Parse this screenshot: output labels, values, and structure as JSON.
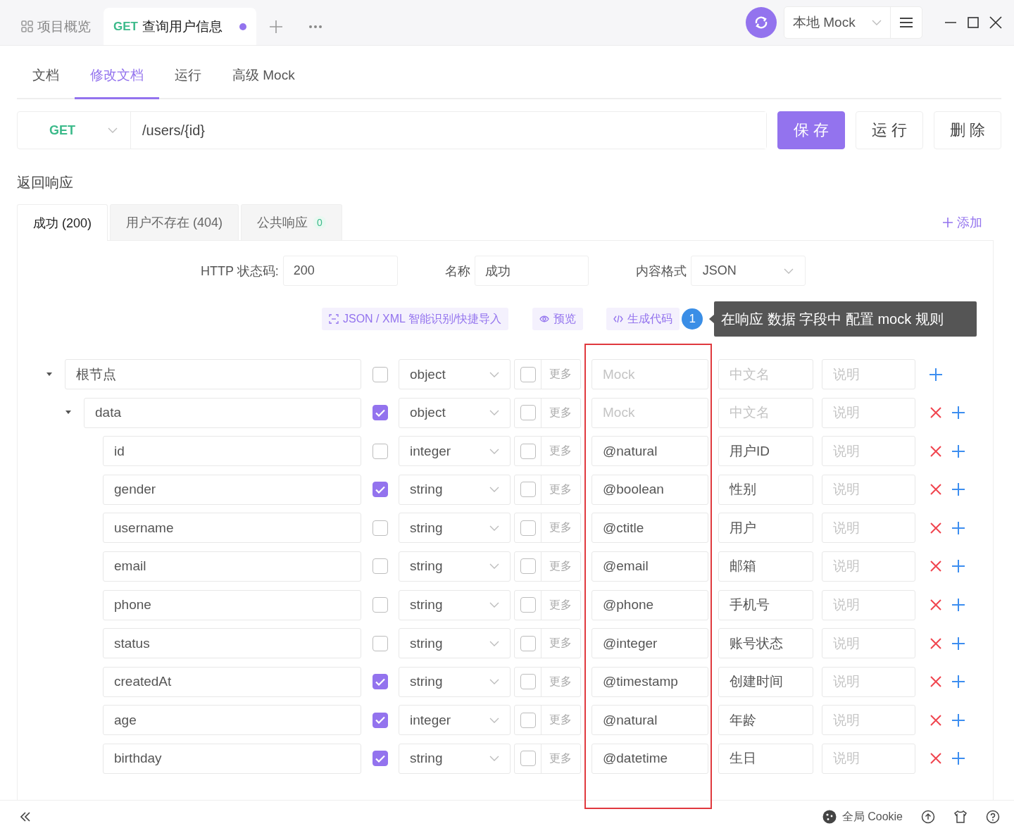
{
  "tabs": [
    {
      "kind": "overview",
      "label": "项目概览",
      "selected": false
    },
    {
      "kind": "request",
      "method": "GET",
      "label": "查询用户信息",
      "selected": true,
      "unsaved": true
    }
  ],
  "environment": {
    "label": "本地 Mock"
  },
  "subtabs": [
    {
      "label": "文档",
      "selected": false
    },
    {
      "label": "修改文档",
      "selected": true
    },
    {
      "label": "运行",
      "selected": false
    },
    {
      "label": "高级 Mock",
      "selected": false
    }
  ],
  "request": {
    "method": "GET",
    "path": "/users/{id}"
  },
  "actions": [
    {
      "label": "保 存",
      "kind": "primary"
    },
    {
      "label": "运 行",
      "kind": "default"
    },
    {
      "label": "删 除",
      "kind": "default"
    }
  ],
  "section_title": "返回响应",
  "response_tabs": [
    {
      "label": "成功 (200)",
      "selected": true
    },
    {
      "label": "用户不存在 (404)",
      "selected": false
    },
    {
      "label": "公共响应",
      "badge": "0",
      "selected": false
    }
  ],
  "add_label": "添加",
  "form": {
    "status_label": "HTTP 状态码:",
    "status": "200",
    "name_label": "名称",
    "name": "成功",
    "format_label": "内容格式",
    "format": "JSON"
  },
  "tools": [
    {
      "kind": "import",
      "label": "JSON / XML 智能识别/快捷导入"
    },
    {
      "kind": "preview",
      "label": "预览"
    },
    {
      "kind": "code",
      "label": "生成代码"
    }
  ],
  "callout": {
    "number": "1",
    "text": "在响应 数据 字段中 配置 mock 规则"
  },
  "schema": {
    "name": "根节点",
    "required": false,
    "type": "object",
    "nullable": false,
    "more": "更多",
    "mock_placeholder": "Mock",
    "title_placeholder": "中文名",
    "description_placeholder": "说明",
    "expanded": true,
    "deletable": false,
    "children": [
      {
        "name": "data",
        "required": true,
        "type": "object",
        "nullable": false,
        "more": "更多",
        "mock_placeholder": "Mock",
        "title_placeholder": "中文名",
        "description_placeholder": "说明",
        "expanded": true,
        "deletable": true,
        "children": [
          {
            "name": "id",
            "required": false,
            "type": "integer",
            "nullable": false,
            "more": "更多",
            "mock": "@natural",
            "title": "用户ID",
            "description_placeholder": "说明",
            "deletable": true
          },
          {
            "name": "gender",
            "required": true,
            "type": "string",
            "nullable": false,
            "more": "更多",
            "mock": "@boolean",
            "title": "性别",
            "description_placeholder": "说明",
            "deletable": true
          },
          {
            "name": "username",
            "required": false,
            "type": "string",
            "nullable": false,
            "more": "更多",
            "mock": "@ctitle",
            "title": "用户",
            "description_placeholder": "说明",
            "deletable": true
          },
          {
            "name": "email",
            "required": false,
            "type": "string",
            "nullable": false,
            "more": "更多",
            "mock": "@email",
            "title": "邮箱",
            "description_placeholder": "说明",
            "deletable": true
          },
          {
            "name": "phone",
            "required": false,
            "type": "string",
            "nullable": false,
            "more": "更多",
            "mock": "@phone",
            "title": "手机号",
            "description_placeholder": "说明",
            "deletable": true
          },
          {
            "name": "status",
            "required": false,
            "type": "string",
            "nullable": false,
            "more": "更多",
            "mock": "@integer",
            "title": "账号状态",
            "description_placeholder": "说明",
            "deletable": true
          },
          {
            "name": "createdAt",
            "required": true,
            "type": "string",
            "nullable": false,
            "more": "更多",
            "mock": "@timestamp",
            "title": "创建时间",
            "description_placeholder": "说明",
            "deletable": true
          },
          {
            "name": "age",
            "required": true,
            "type": "integer",
            "nullable": false,
            "more": "更多",
            "mock": "@natural",
            "title": "年龄",
            "description_placeholder": "说明",
            "deletable": true
          },
          {
            "name": "birthday",
            "required": true,
            "type": "string",
            "nullable": false,
            "more": "更多",
            "mock": "@datetime",
            "title": "生日",
            "description_placeholder": "说明",
            "deletable": true
          }
        ]
      }
    ]
  },
  "footer": {
    "cookie": "全局 Cookie"
  }
}
